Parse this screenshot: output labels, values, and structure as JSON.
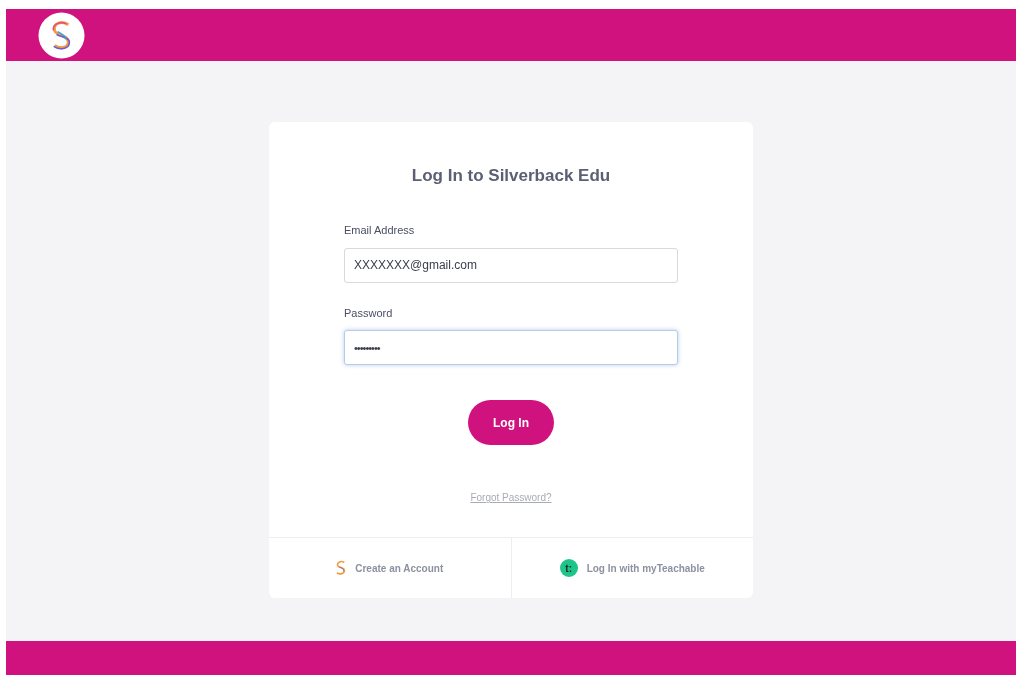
{
  "login_card": {
    "title": "Log In to Silverback Edu",
    "fields": [
      {
        "kind": "email",
        "label": "Email Address",
        "value": "XXXXXXX@gmail.com",
        "focused": false
      },
      {
        "kind": "password",
        "label": "Password",
        "value": "•••••••••",
        "focused": true
      }
    ],
    "submit_button": "Log In",
    "forgot_link": "Forgot Password?",
    "footer_links": [
      {
        "kind": "silverback",
        "label": "Create an Account"
      },
      {
        "kind": "teachable",
        "label": "Log In with myTeachable",
        "icon_text": "t:"
      }
    ]
  }
}
